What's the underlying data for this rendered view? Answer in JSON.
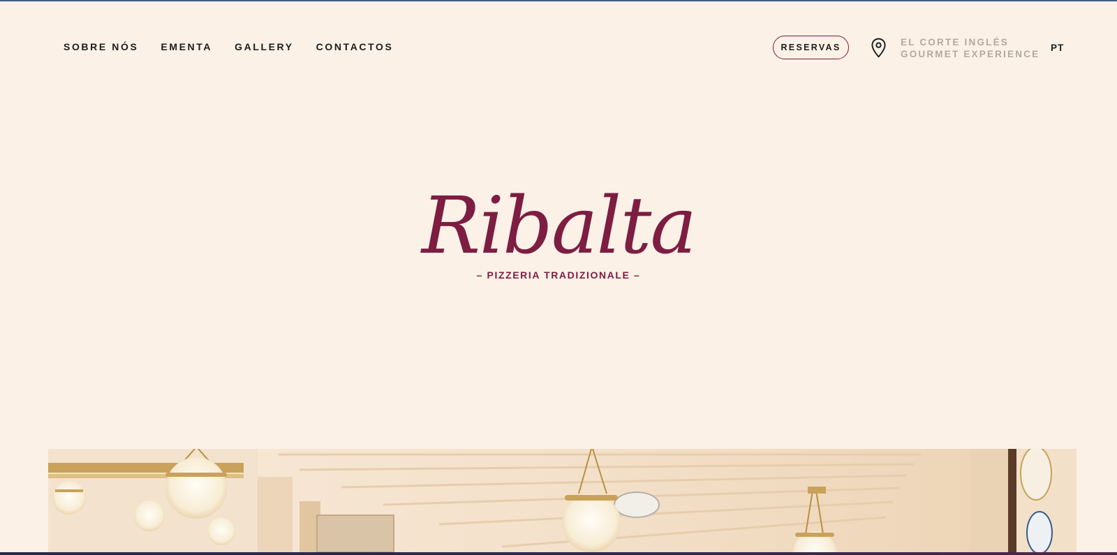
{
  "nav": {
    "links": [
      "SOBRE NÓS",
      "EMENTA",
      "GALLERY",
      "CONTACTOS"
    ],
    "reserve_label": "RESERVAS",
    "location": {
      "line1": "EL CORTE INGLÉS",
      "line2": "GOURMET EXPERIENCE",
      "icon": "map-pin-icon"
    },
    "language": "PT"
  },
  "brand": {
    "name": "Ribalta",
    "tagline": "– PIZZERIA TRADIZIONALE –"
  },
  "colors": {
    "background": "#fbf1e7",
    "brand": "#7d1d42",
    "text": "#1c1c1c",
    "muted": "#b3a99f"
  }
}
